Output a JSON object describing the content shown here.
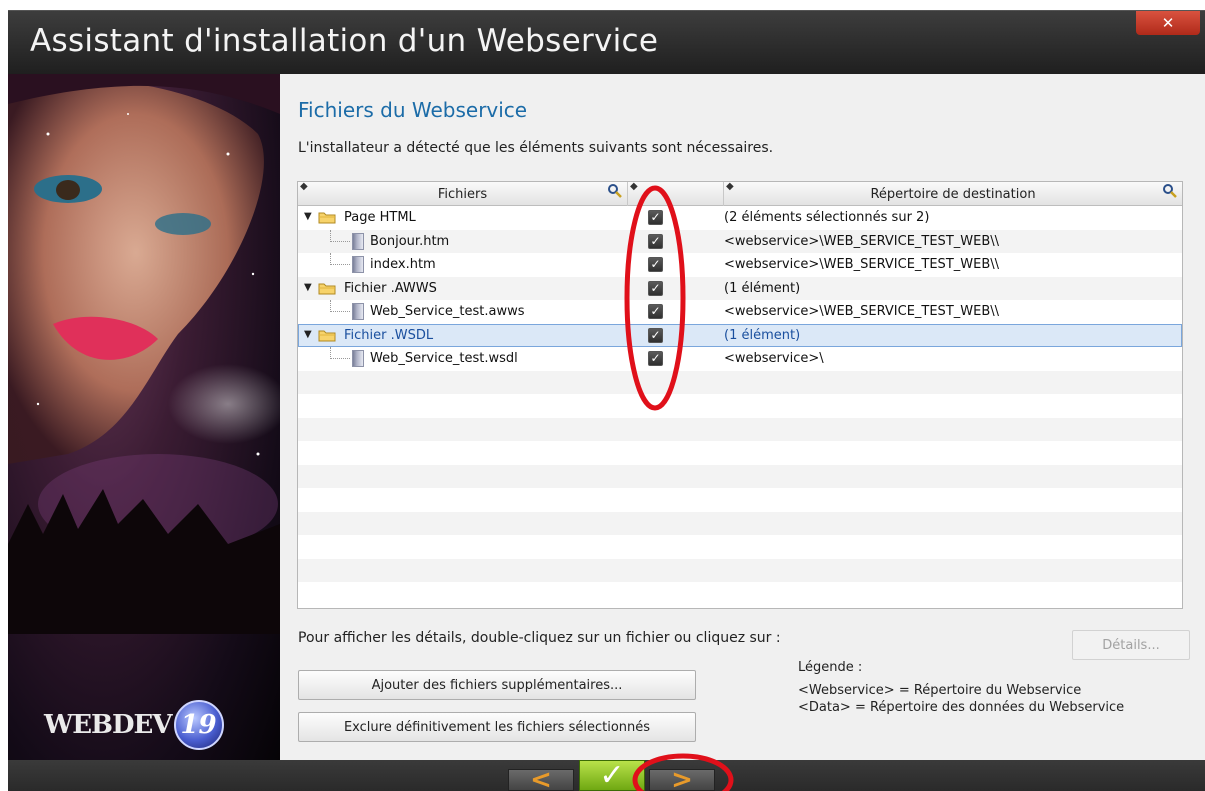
{
  "window": {
    "title": "Assistant d'installation d'un Webservice",
    "close_label": "✕"
  },
  "brand": {
    "logo_text": "WEBDEV",
    "logo_version": "19"
  },
  "content": {
    "heading": "Fichiers du Webservice",
    "subtitle": "L'installateur a détecté que les éléments suivants sont nécessaires."
  },
  "table": {
    "headers": {
      "files": "Fichiers",
      "destination": "Répertoire de destination"
    },
    "rows": [
      {
        "name": "Page HTML",
        "type": "folder",
        "checked": true,
        "destination": "(2 éléments sélectionnés sur 2)"
      },
      {
        "name": "Bonjour.htm",
        "type": "file",
        "checked": true,
        "destination": "<webservice>\\WEB_SERVICE_TEST_WEB\\\\"
      },
      {
        "name": "index.htm",
        "type": "file",
        "checked": true,
        "destination": "<webservice>\\WEB_SERVICE_TEST_WEB\\\\"
      },
      {
        "name": "Fichier .AWWS",
        "type": "folder",
        "checked": true,
        "destination": "(1 élément)"
      },
      {
        "name": "Web_Service_test.awws",
        "type": "file",
        "checked": true,
        "destination": "<webservice>\\WEB_SERVICE_TEST_WEB\\\\"
      },
      {
        "name": "Fichier .WSDL",
        "type": "folder",
        "checked": true,
        "destination": "(1 élément)",
        "selected": true
      },
      {
        "name": "Web_Service_test.wsdl",
        "type": "file",
        "checked": true,
        "destination": "<webservice>\\"
      }
    ],
    "empty_rows": 10
  },
  "hint_text": "Pour afficher les détails, double-cliquez sur un fichier ou cliquez sur :",
  "buttons": {
    "details": "Détails...",
    "add_files": "Ajouter des fichiers supplémentaires...",
    "exclude_files": "Exclure définitivement les fichiers sélectionnés"
  },
  "legend": {
    "title": "Légende :",
    "items": [
      "<Webservice> = Répertoire du Webservice",
      "<Data> = Répertoire des données du Webservice"
    ]
  },
  "nav": {
    "previous": "<",
    "finish": "✓",
    "next": ">"
  },
  "colors": {
    "heading": "#1c6ca8",
    "annotation": "#e0101a",
    "finish": "#7fb51b",
    "nav_arrow": "#e89a2a"
  }
}
